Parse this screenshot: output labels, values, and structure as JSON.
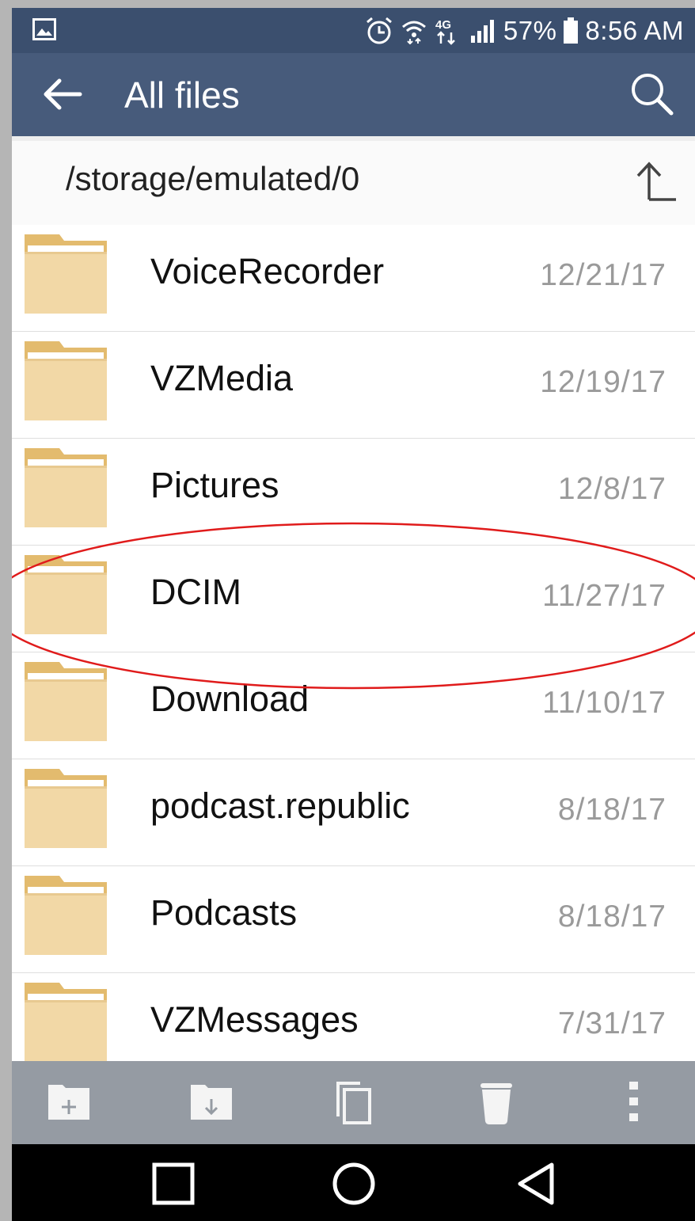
{
  "status_bar": {
    "battery_percent": "57%",
    "time": "8:56 AM",
    "network_label": "4G",
    "left_icon": "image-icon",
    "icons": [
      "alarm-icon",
      "wifi-icon",
      "network-4g-icon",
      "signal-icon",
      "battery-icon"
    ]
  },
  "app_bar": {
    "title": "All files",
    "back_icon": "back-arrow-icon",
    "search_icon": "search-icon"
  },
  "path_bar": {
    "path": "/storage/emulated/0",
    "up_icon": "folder-up-icon"
  },
  "files": [
    {
      "name": "VoiceRecorder",
      "date": "12/21/17"
    },
    {
      "name": "VZMedia",
      "date": "12/19/17"
    },
    {
      "name": "Pictures",
      "date": "12/8/17"
    },
    {
      "name": "DCIM",
      "date": "11/27/17"
    },
    {
      "name": "Download",
      "date": "11/10/17"
    },
    {
      "name": "podcast.republic",
      "date": "8/18/17"
    },
    {
      "name": "Podcasts",
      "date": "8/18/17"
    },
    {
      "name": "VZMessages",
      "date": "7/31/17"
    }
  ],
  "toolbar": {
    "items": [
      "new-folder-icon",
      "download-folder-icon",
      "copy-icon",
      "delete-icon",
      "more-options-icon"
    ]
  },
  "nav_bar": {
    "items": [
      "recents-icon",
      "home-icon",
      "back-icon"
    ]
  },
  "colors": {
    "status_bar": "#3b4f6e",
    "app_bar": "#475b7b",
    "folder_body": "#f2d8a6",
    "folder_tab": "#e3bb6e",
    "toolbar": "#959ba3",
    "annotation": "#e01b1b",
    "date_text": "#9a9a9a"
  }
}
